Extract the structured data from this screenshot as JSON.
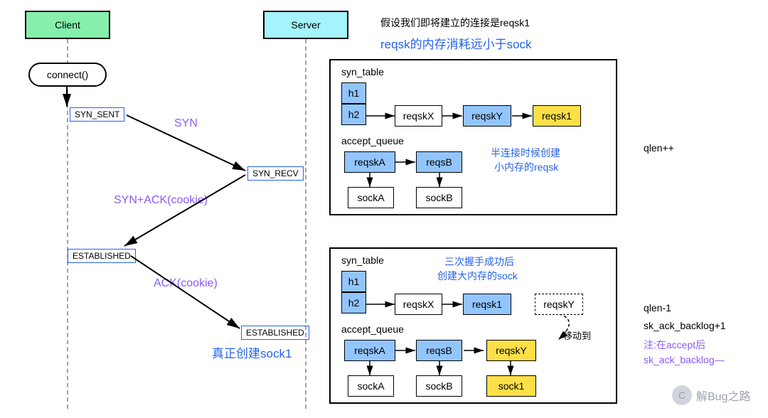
{
  "actors": {
    "client": "Client",
    "server": "Server"
  },
  "connect": "connect()",
  "states": {
    "syn_sent": "SYN_SENT",
    "syn_recv": "SYN_RECV",
    "established1": "ESTABLISHED",
    "established2": "ESTABLISHED"
  },
  "messages": {
    "syn": "SYN",
    "syn_ack": "SYN+ACK(cookie)",
    "ack": "ACK(cookie)"
  },
  "top_notes": {
    "line1": "假设我们即将建立的连接是reqsk1",
    "line2": "reqsk的内存消耗远小于sock"
  },
  "bottom_note": "真正创建sock1",
  "panel1": {
    "syn_table_label": "syn_table",
    "h1": "h1",
    "h2": "h2",
    "reqskX": "reqskX",
    "reqskY": "reqskY",
    "reqsk1": "reqsk1",
    "accept_queue_label": "accept_queue",
    "reqskA": "reqskA",
    "reqsB": "reqsB",
    "sockA": "sockA",
    "sockB": "sockB",
    "note1": "半连接时候创建",
    "note2": "小内存的reqsk",
    "side_note": "qlen++"
  },
  "panel2": {
    "syn_table_label": "syn_table",
    "h1": "h1",
    "h2": "h2",
    "reqskX": "reqskX",
    "reqsk1": "reqsk1",
    "reqskY": "reqskY",
    "accept_queue_label": "accept_queue",
    "reqskA": "reqskA",
    "reqsB": "reqsB",
    "sockA": "sockA",
    "sockB": "sockB",
    "sock1": "sock1",
    "note1": "三次握手成功后",
    "note2": "创建大内存的sock",
    "move_label": "移动到",
    "side1": "qlen-1",
    "side2": "sk_ack_backlog+1",
    "side3": "注:在accept后",
    "side4": "sk_ack_backlog—"
  },
  "watermark": "解Bug之路"
}
